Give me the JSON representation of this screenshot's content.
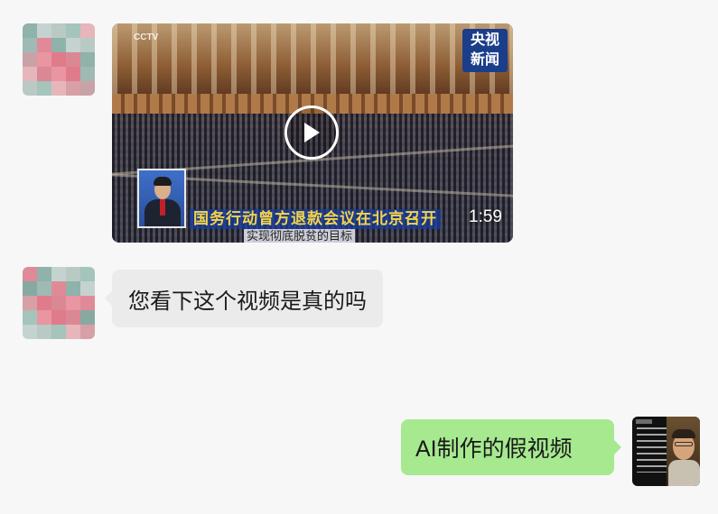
{
  "messages": [
    {
      "side": "left",
      "type": "video",
      "avatar": "pixelated-avatar",
      "video": {
        "channel_logo": "CCTV",
        "channel_sub": "",
        "badge_line1": "央视",
        "badge_line2": "新闻",
        "caption_title": "国务行动曾方退款会议在北京召开",
        "caption_subtitle": "实现彻底脱贫的目标",
        "duration": "1:59"
      }
    },
    {
      "side": "left",
      "type": "text",
      "avatar": "pixelated-avatar",
      "text": "您看下这个视频是真的吗"
    },
    {
      "side": "right",
      "type": "text",
      "avatar": "user-photo-avatar",
      "text": "AI制作的假视频"
    }
  ],
  "colors": {
    "background": "#f7f7f7",
    "incoming_bubble": "#ebebeb",
    "outgoing_bubble": "#a6e98f",
    "badge": "#1b3e8a",
    "caption_text": "#f5d44a"
  }
}
